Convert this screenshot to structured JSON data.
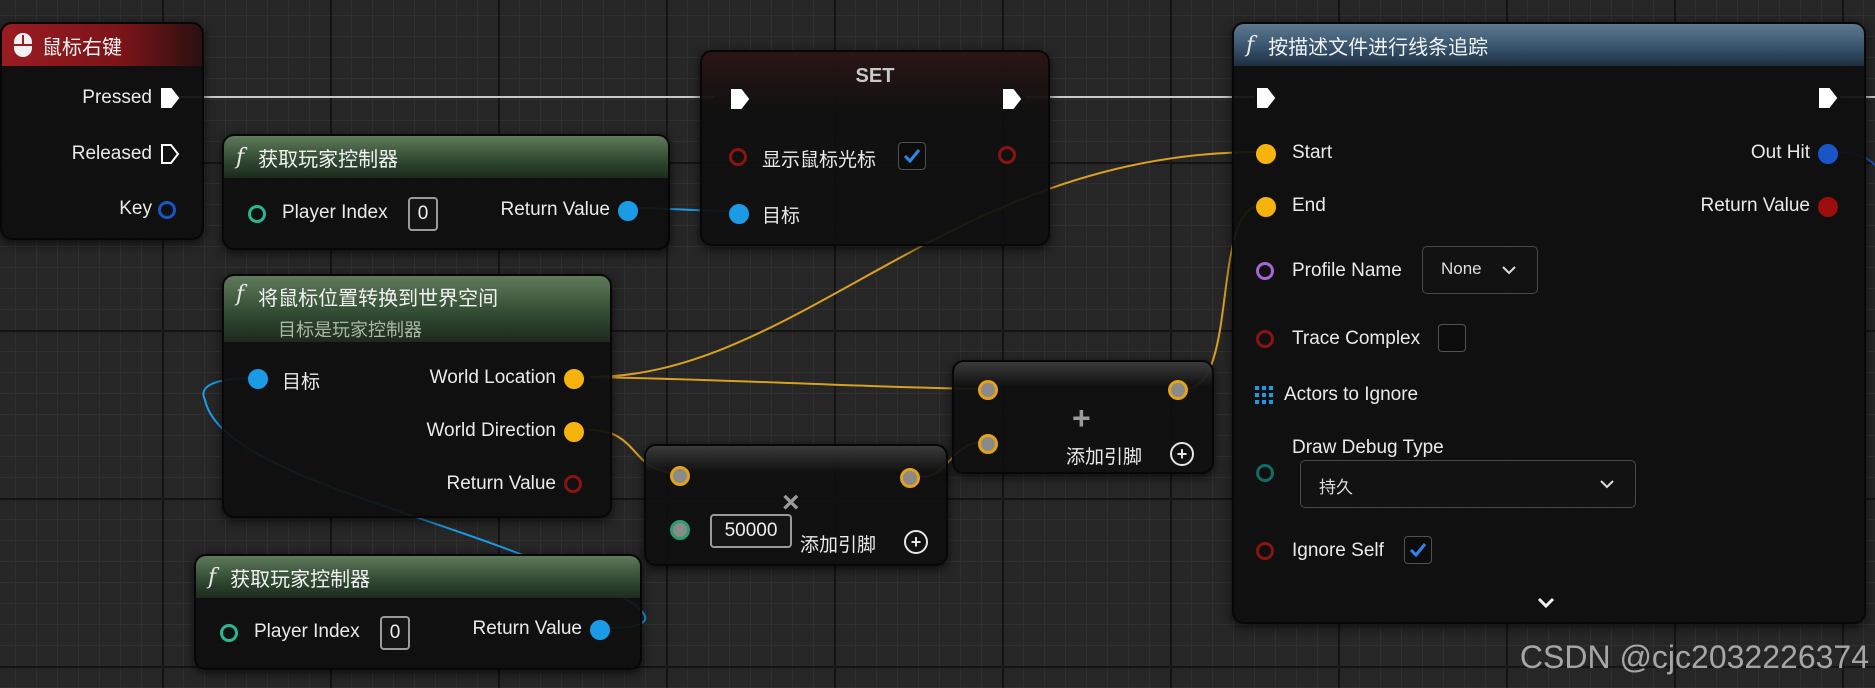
{
  "event_node": {
    "title": "鼠标右键",
    "pins": {
      "pressed": "Pressed",
      "released": "Released",
      "key": "Key"
    }
  },
  "get_controller_1": {
    "title": "获取玩家控制器",
    "input_label": "Player Index",
    "input_value": "0",
    "output_label": "Return Value"
  },
  "set_node": {
    "title": "SET",
    "field_label": "显示鼠标光标",
    "field_checked": true,
    "target_label": "目标"
  },
  "deproject_node": {
    "title": "将鼠标位置转换到世界空间",
    "subtitle": "目标是玩家控制器",
    "target_label": "目标",
    "world_location": "World Location",
    "world_direction": "World Direction",
    "return_value": "Return Value"
  },
  "get_controller_2": {
    "title": "获取玩家控制器",
    "input_label": "Player Index",
    "input_value": "0",
    "output_label": "Return Value"
  },
  "multiply_node": {
    "symbol": "×",
    "value": "50000",
    "add_pin_label": "添加引脚"
  },
  "add_node": {
    "symbol": "+",
    "add_pin_label": "添加引脚"
  },
  "trace_node": {
    "title": "按描述文件进行线条追踪",
    "start": "Start",
    "end": "End",
    "out_hit": "Out Hit",
    "return_value": "Return Value",
    "profile_name_label": "Profile Name",
    "profile_name_value": "None",
    "trace_complex_label": "Trace Complex",
    "trace_complex_checked": false,
    "actors_to_ignore_label": "Actors to Ignore",
    "draw_debug_type_label": "Draw Debug Type",
    "draw_debug_type_value": "持久",
    "ignore_self_label": "Ignore Self",
    "ignore_self_checked": true
  },
  "watermark": "CSDN @cjc2032226374",
  "colors": {
    "exec": "#ffffff",
    "vector": "#f5b30c",
    "object": "#1b9be6",
    "boolean": "#9c0d0d",
    "struct": "#1a55c8",
    "name": "#a566d8",
    "int": "#25b893"
  }
}
